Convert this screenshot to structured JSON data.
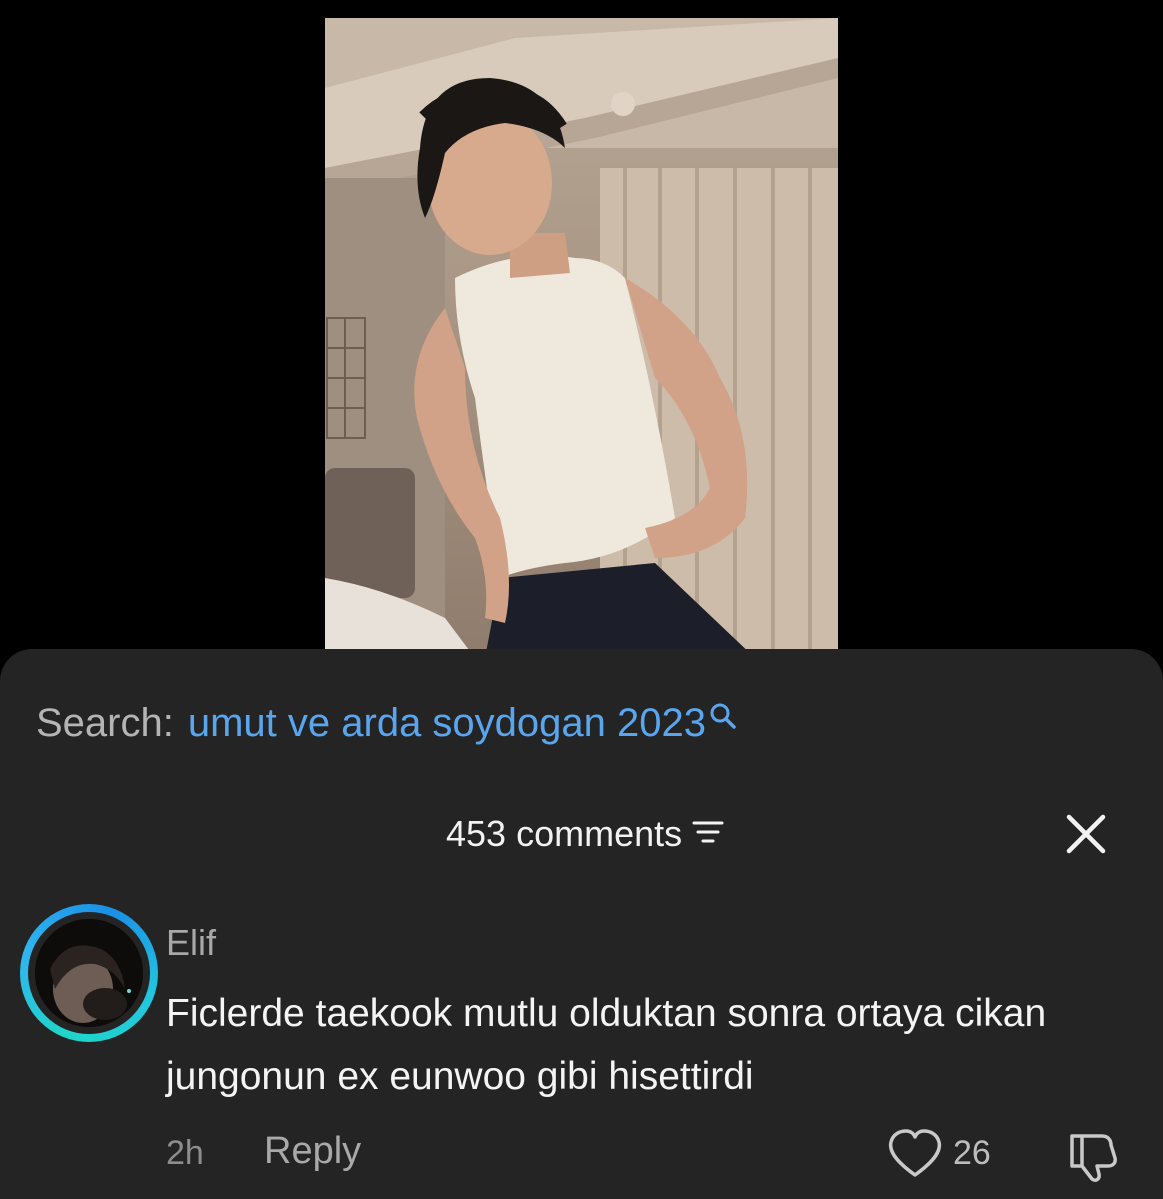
{
  "video": {
    "description_icon": "person-dancing-photo"
  },
  "search": {
    "label": "Search:",
    "query": "umut ve arda soydogan 2023",
    "icon": "search-icon",
    "query_color": "#5aa6ee"
  },
  "comments_header": {
    "count_label": "453 comments",
    "sort_icon": "sort-icon",
    "close_icon": "close-icon"
  },
  "comment": {
    "username": "Elif",
    "text": "Ficlerde taekook mutlu olduktan sonra ortaya cikan jungonun ex eunwoo gibi hisettirdi",
    "time": "2h",
    "reply_label": "Reply",
    "like_count": "26",
    "like_icon": "heart-icon",
    "dislike_icon": "thumbs-down-icon",
    "avatar_ring_color": "#1fb6e8"
  },
  "theme": {
    "sheet_background": "#242424",
    "page_background": "#000000"
  }
}
